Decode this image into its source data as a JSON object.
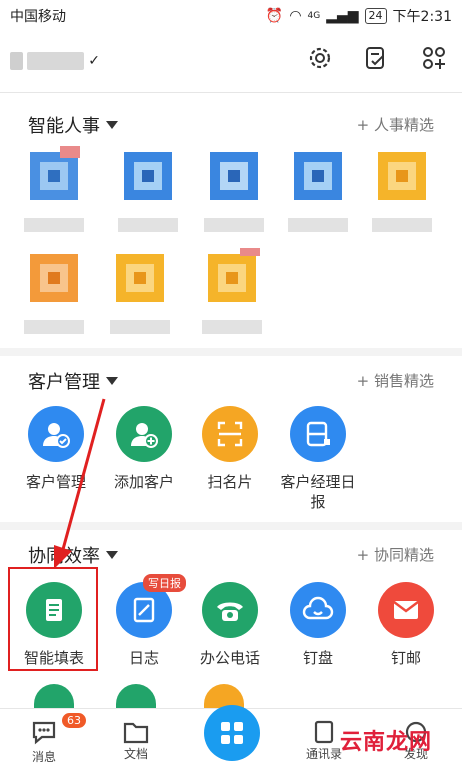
{
  "status": {
    "carrier": "中国移动",
    "battery": "24",
    "time": "下午2:31",
    "network": "4G"
  },
  "header": {
    "icons": [
      "settings-icon",
      "task-check-icon",
      "apps-add-icon"
    ]
  },
  "sections": {
    "hr": {
      "title": "智能人事",
      "more": "+ 人事精选"
    },
    "crm": {
      "title": "客户管理",
      "more": "+ 销售精选",
      "apps": [
        {
          "label": "客户管理",
          "color": "#2f8af0",
          "icon": "customer-manage-icon"
        },
        {
          "label": "添加客户",
          "color": "#22a46a",
          "icon": "add-customer-icon"
        },
        {
          "label": "扫名片",
          "color": "#f5a623",
          "icon": "scan-card-icon"
        },
        {
          "label": "客户经理日报",
          "color": "#2f8af0",
          "icon": "manager-daily-icon"
        }
      ]
    },
    "collab": {
      "title": "协同效率",
      "more": "+ 协同精选",
      "apps": [
        {
          "label": "智能填表",
          "color": "#22a46a",
          "icon": "smart-form-icon"
        },
        {
          "label": "日志",
          "color": "#2f8af0",
          "icon": "log-icon",
          "badge": "写日报"
        },
        {
          "label": "办公电话",
          "color": "#22a46a",
          "icon": "office-phone-icon"
        },
        {
          "label": "钉盘",
          "color": "#2f8af0",
          "icon": "ding-disk-icon"
        },
        {
          "label": "钉邮",
          "color": "#ef4a3c",
          "icon": "ding-mail-icon"
        }
      ]
    }
  },
  "nav": {
    "messages": "消息",
    "messages_badge": "63",
    "docs": "文档",
    "contacts": "通讯录",
    "discover": "发现"
  },
  "watermark": "云南龙网"
}
